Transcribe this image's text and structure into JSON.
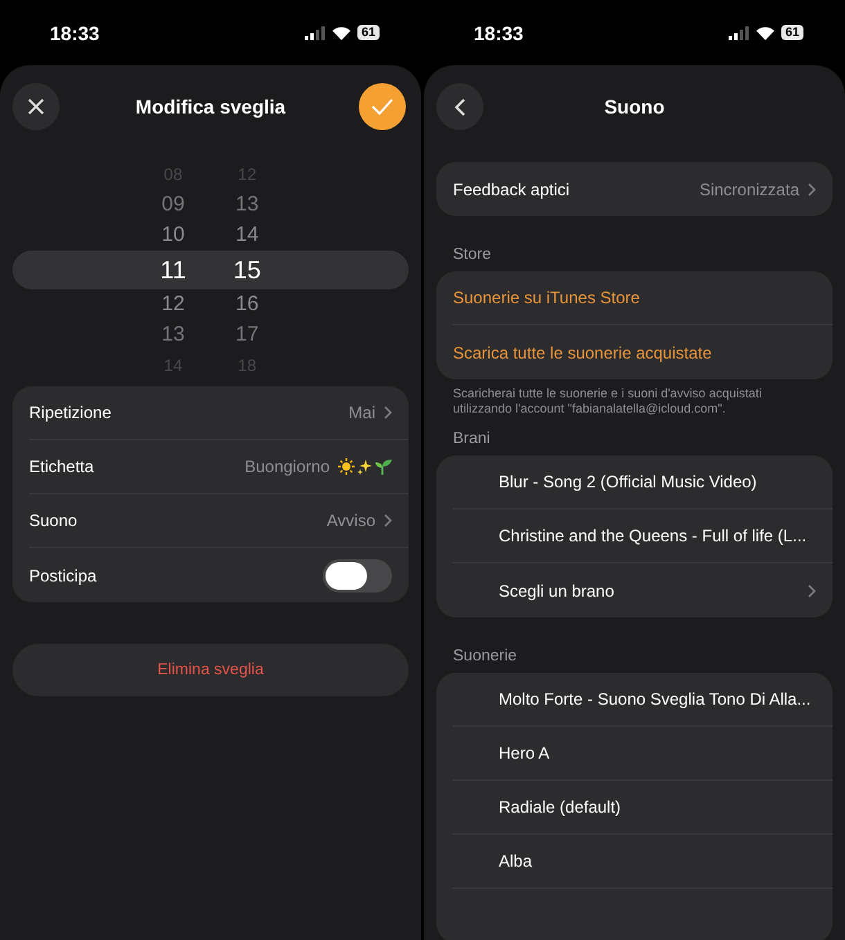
{
  "status_bars": [
    {
      "time": "18:33",
      "battery": "61"
    },
    {
      "time": "18:33",
      "battery": "61"
    }
  ],
  "alarm": {
    "title": "Modifica sveglia",
    "hours": [
      {
        "value": "08",
        "selected": false
      },
      {
        "value": "09",
        "selected": false
      },
      {
        "value": "10",
        "selected": false
      },
      {
        "value": "11",
        "selected": true
      },
      {
        "value": "12",
        "selected": false
      },
      {
        "value": "13",
        "selected": false
      },
      {
        "value": "14",
        "selected": false
      }
    ],
    "minutes": [
      {
        "value": "12",
        "selected": false
      },
      {
        "value": "13",
        "selected": false
      },
      {
        "value": "14",
        "selected": false
      },
      {
        "value": "15",
        "selected": true
      },
      {
        "value": "16",
        "selected": false
      },
      {
        "value": "17",
        "selected": false
      },
      {
        "value": "18",
        "selected": false
      }
    ],
    "settings": [
      {
        "kind": "link",
        "label": "Ripetizione",
        "value": "Mai"
      },
      {
        "kind": "label",
        "label": "Etichetta",
        "value": "Buongiorno"
      },
      {
        "kind": "link",
        "label": "Suono",
        "value": "Avviso"
      },
      {
        "kind": "toggle",
        "label": "Posticipa",
        "on": false
      }
    ],
    "delete_button": "Elimina sveglia"
  },
  "sound": {
    "title": "Suono",
    "feedback": {
      "label": "Feedback aptici",
      "value": "Sincronizzata"
    },
    "store_header": "Store",
    "store_links": [
      "Suonerie su iTunes Store",
      "Scarica tutte le suonerie acquistate"
    ],
    "store_note": "Scaricherai tutte le suonerie e i suoni d'avviso acquistati utilizzando l'account \"fabianalatella@icloud.com\".",
    "sections": [
      {
        "header": "Brani",
        "items": [
          {
            "kind": "item",
            "label": "Blur - Song 2 (Official Music Video)"
          },
          {
            "kind": "item",
            "label": "Christine and the Queens - Full of life (L..."
          },
          {
            "kind": "link",
            "label": "Scegli un brano"
          }
        ]
      },
      {
        "header": "Suonerie",
        "items": [
          {
            "kind": "item",
            "label": "Molto Forte - Suono Sveglia Tono Di Alla..."
          },
          {
            "kind": "item",
            "label": "Hero A"
          },
          {
            "kind": "item",
            "label": "Radiale (default)"
          },
          {
            "kind": "item",
            "label": "Alba"
          }
        ]
      }
    ]
  }
}
